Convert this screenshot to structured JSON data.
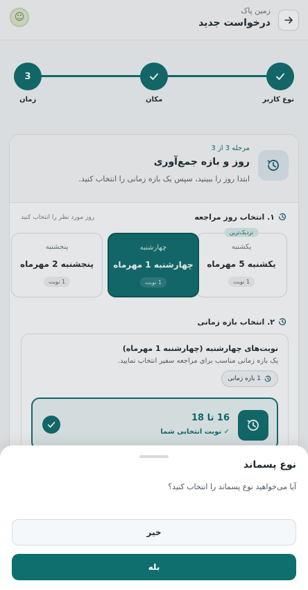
{
  "header": {
    "subtitle": "زمین پاک",
    "title": "درخواست جدید"
  },
  "stepper": {
    "steps": [
      {
        "label": "نوع کاربر",
        "state": "done"
      },
      {
        "label": "مکان",
        "state": "done"
      },
      {
        "label": "زمان",
        "number": "3",
        "state": "current"
      }
    ]
  },
  "card": {
    "step_text": "مرحله 3 از 3",
    "title": "روز و بازه جمع‌آوری",
    "desc": "ابتدا روز را ببینید، سپس یک بازه زمانی را انتخاب کنید."
  },
  "day_section": {
    "title": "۱. انتخاب روز مراجعه",
    "hint": "روز مورد نظر را انتخاب کنید",
    "days": [
      {
        "name": "یکشنبه",
        "date": "یکشنبه 5 مهرماه",
        "count": "1 نوبت",
        "badge": "نزدیک‌ترین"
      },
      {
        "name": "چهارشنبه",
        "date": "چهارشنبه 1 مهرماه",
        "count": "1 نوبت"
      },
      {
        "name": "پنجشنبه",
        "date": "پنجشنبه 2 مهرماه",
        "count": "1 نوبت"
      }
    ]
  },
  "slot_section": {
    "title": "۲. انتخاب بازه زمانی",
    "box_title": "نوبت‌های چهارشنبه (چهارشنبه 1 مهرماه)",
    "box_desc": "یک بازه زمانی مناسب برای مراجعه سفیر انتخاب نمایید.",
    "pill": "1 بازه زمانی",
    "slot_time": "16 تا 18",
    "slot_label": "✓ نوبت انتخابی شما"
  },
  "sheet": {
    "title": "نوع پسماند",
    "question": "آیا می‌خواهید نوع پسماند را انتخاب کنید؟",
    "no_label": "خیر",
    "yes_label": "بله"
  },
  "colors": {
    "primary": "#0f6e6e",
    "background": "#f3f5f7"
  },
  "icons": [
    "arrow-right-icon",
    "logo-icon",
    "check-icon",
    "history-clock-icon"
  ]
}
